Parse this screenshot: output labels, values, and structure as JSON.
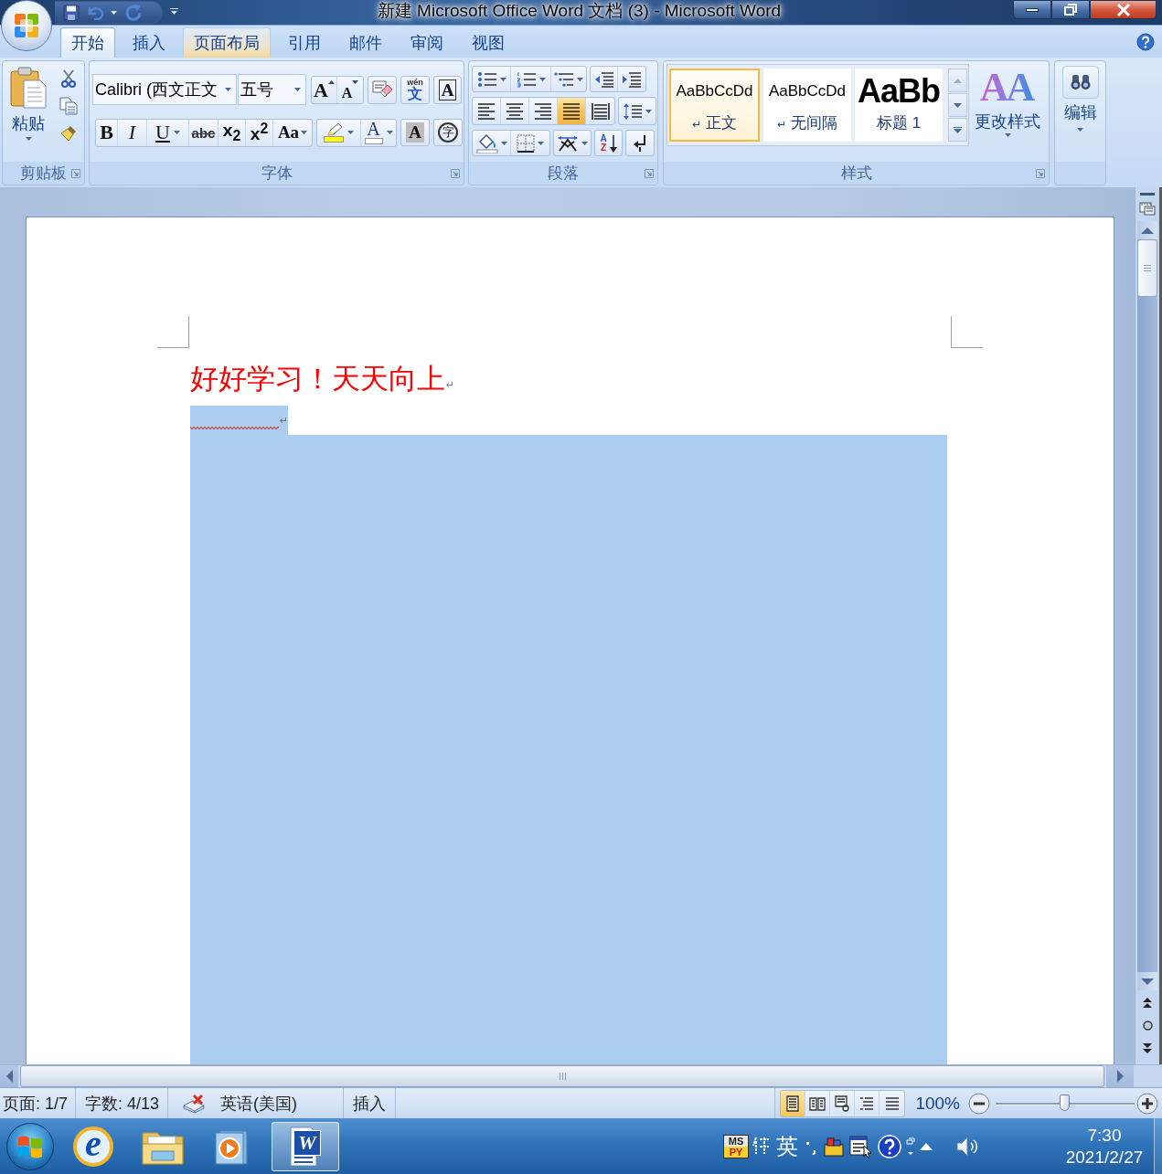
{
  "window": {
    "title": "新建 Microsoft Office Word 文档 (3) - Microsoft Word"
  },
  "ribbon_tabs": [
    {
      "label": "开始",
      "selected": true,
      "hovered": false
    },
    {
      "label": "插入",
      "selected": false,
      "hovered": false
    },
    {
      "label": "页面布局",
      "selected": false,
      "hovered": true
    },
    {
      "label": "引用",
      "selected": false,
      "hovered": false
    },
    {
      "label": "邮件",
      "selected": false,
      "hovered": false
    },
    {
      "label": "审阅",
      "selected": false,
      "hovered": false
    },
    {
      "label": "视图",
      "selected": false,
      "hovered": false
    }
  ],
  "clipboard": {
    "label": "剪贴板",
    "paste": "粘贴"
  },
  "font": {
    "label": "字体",
    "font_name": "Calibri (西文正文",
    "font_size": "五号",
    "grow": "A",
    "shrink": "A",
    "phonetic_top": "wén",
    "phonetic": "文",
    "border": "A",
    "bold": "B",
    "italic": "I",
    "underline": "U",
    "strikethrough": "abc",
    "subscript": "x$_{2}$",
    "superscript": "x$^{2}$",
    "change_case": "Aa",
    "highlight": {
      "color": "#ffff00"
    },
    "font_color": {
      "glyph": "A",
      "color": "#ffffff"
    },
    "shading": "A",
    "enclosed": "字"
  },
  "paragraph": {
    "label": "段落",
    "alignment": [
      {
        "kind": "left",
        "selected": false
      },
      {
        "kind": "center",
        "selected": false
      },
      {
        "kind": "right",
        "selected": false
      },
      {
        "kind": "justify",
        "selected": true
      },
      {
        "kind": "distributed",
        "selected": false
      }
    ],
    "sort_top": "A",
    "sort_bottom": "Z"
  },
  "styles": {
    "label": "样式",
    "gallery": [
      {
        "kind": "normal",
        "preview": "AaBbCcDd",
        "mark": "↵",
        "name": "正文",
        "selected": true
      },
      {
        "kind": "no_spacing",
        "preview": "AaBbCcDd",
        "mark": "↵",
        "name": "无间隔",
        "selected": false
      },
      {
        "kind": "heading",
        "preview": "AaBb",
        "name": "标题 1",
        "selected": false
      }
    ],
    "change_styles": {
      "glyph": "AA",
      "label": "更改样式"
    }
  },
  "editing": {
    "label": "编辑"
  },
  "document": {
    "heading": "好好学习！天天向上",
    "heading_mark": "↵",
    "selection_mark": "↵",
    "spelling_error": true
  },
  "status_bar": {
    "page": "页面: 1/7",
    "words": "字数: 4/13",
    "language": "英语(美国)",
    "mode": "插入",
    "view_buttons": [
      {
        "kind": "print_layout",
        "selected": true
      },
      {
        "kind": "reading",
        "selected": false
      },
      {
        "kind": "web",
        "selected": false
      },
      {
        "kind": "outline",
        "selected": false
      },
      {
        "kind": "draft",
        "selected": false
      }
    ],
    "zoom": "100%",
    "zoom_slider": {
      "level": 0.5
    }
  },
  "taskbar": {
    "items": [
      {
        "kind": "browser",
        "glyph": "e",
        "selected": false
      },
      {
        "kind": "folder",
        "selected": false
      },
      {
        "kind": "media",
        "selected": false
      },
      {
        "kind": "document",
        "glyph": "W",
        "selected": true
      }
    ],
    "ime_logo_top": "MS",
    "ime_logo_bottom": "PY",
    "ime_mode": "英",
    "time": "7:30",
    "date": "2021/2/27"
  }
}
